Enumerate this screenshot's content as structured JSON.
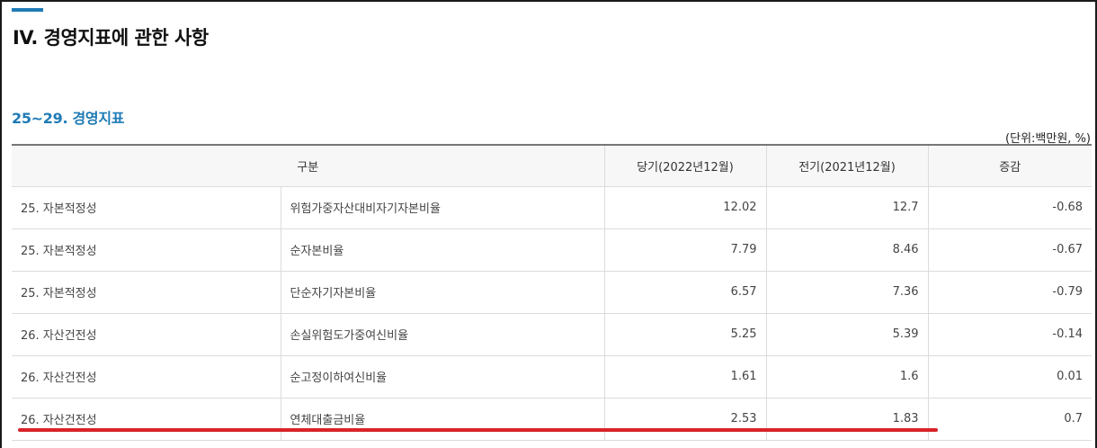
{
  "colors": {
    "accent": "#1f7bb5",
    "highlight_line": "#d8232a"
  },
  "heading": "IV. 경영지표에 관한 사항",
  "subheading": "25~29. 경영지표",
  "unit": "(단위:백만원, %)",
  "table": {
    "headers": [
      "구분",
      "당기(2022년12월)",
      "전기(2021년12월)",
      "증감"
    ],
    "rows": [
      {
        "category": "25. 자본적정성",
        "item": "위험가중자산대비자기자본비율",
        "current": "12.02",
        "previous": "12.7",
        "change": "-0.68"
      },
      {
        "category": "25. 자본적정성",
        "item": "순자본비율",
        "current": "7.79",
        "previous": "8.46",
        "change": "-0.67"
      },
      {
        "category": "25. 자본적정성",
        "item": "단순자기자본비율",
        "current": "6.57",
        "previous": "7.36",
        "change": "-0.79"
      },
      {
        "category": "26. 자산건전성",
        "item": "손실위험도가중여신비율",
        "current": "5.25",
        "previous": "5.39",
        "change": "-0.14"
      },
      {
        "category": "26. 자산건전성",
        "item": "순고정이하여신비율",
        "current": "1.61",
        "previous": "1.6",
        "change": "0.01"
      },
      {
        "category": "26. 자산건전성",
        "item": "연체대출금비율",
        "current": "2.53",
        "previous": "1.83",
        "change": "0.7"
      }
    ]
  }
}
